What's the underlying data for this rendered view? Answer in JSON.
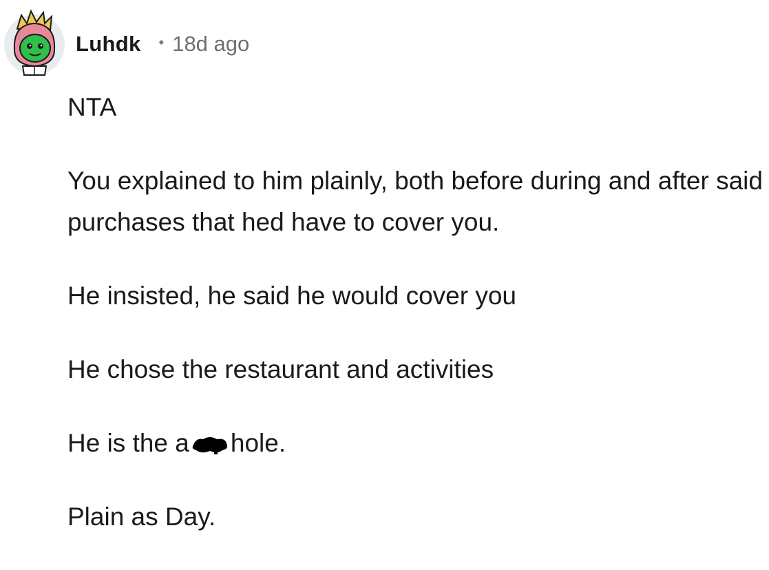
{
  "comment": {
    "username": "Luhdk",
    "separator": "•",
    "timestamp": "18d ago",
    "paragraphs": [
      "NTA",
      "You explained to him plainly, both before during and after said purchases that hed have to cover you.",
      "He insisted, he said he would cover you",
      "He chose the restaurant and activities"
    ],
    "censored_line": {
      "before": "He is the a",
      "after": "hole."
    },
    "closing": "Plain as Day."
  },
  "colors": {
    "text": "#1a1a1b",
    "meta": "#6b6f72",
    "avatar_hair": "#f2c94c",
    "avatar_hood": "#e8899a",
    "avatar_face": "#2fbf4a",
    "avatar_bg": "#e9ecee"
  },
  "icons": {
    "avatar": "snoo-avatar-icon",
    "censor": "scribble-censor-icon"
  }
}
